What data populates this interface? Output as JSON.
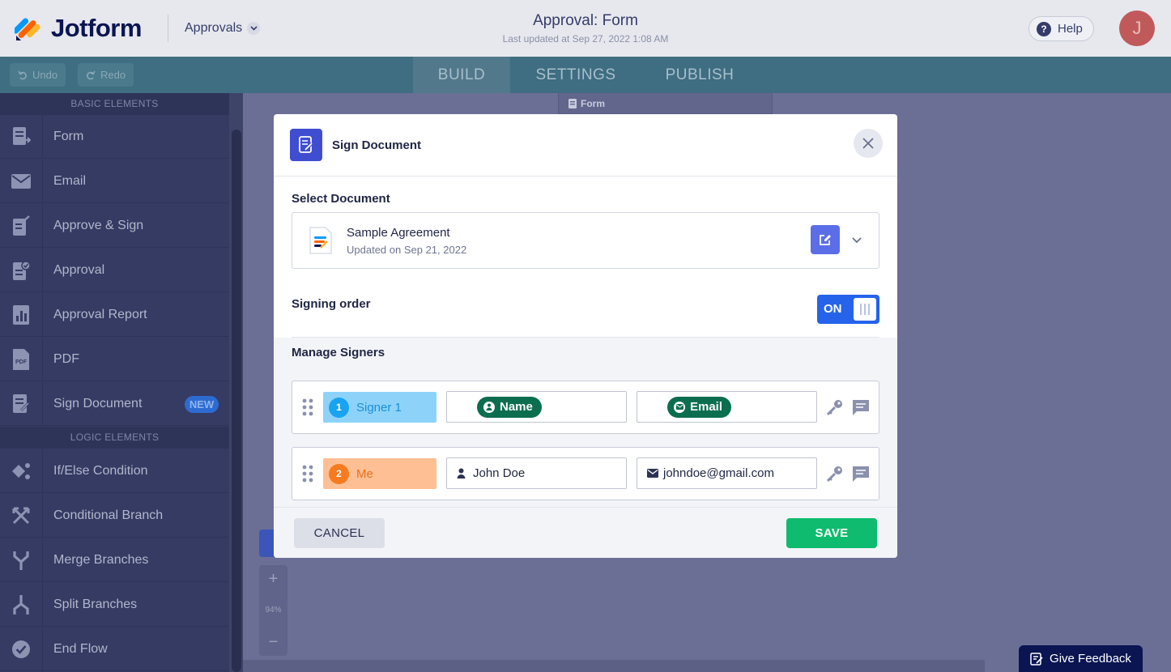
{
  "header": {
    "brand": "Jotform",
    "workspace_dropdown": "Approvals",
    "title": "Approval: Form",
    "updated": "Last updated at Sep 27, 2022 1:08 AM",
    "help_label": "Help",
    "avatar_initial": "J"
  },
  "toolbar": {
    "undo_label": "Undo",
    "redo_label": "Redo",
    "tabs": [
      {
        "label": "BUILD",
        "active": true
      },
      {
        "label": "SETTINGS",
        "active": false
      },
      {
        "label": "PUBLISH",
        "active": false
      }
    ]
  },
  "sidebar": {
    "basic_heading": "BASIC ELEMENTS",
    "basic_items": [
      {
        "label": "Form",
        "icon": "form-icon"
      },
      {
        "label": "Email",
        "icon": "envelope-icon"
      },
      {
        "label": "Approve & Sign",
        "icon": "approve-sign-icon"
      },
      {
        "label": "Approval",
        "icon": "approval-icon"
      },
      {
        "label": "Approval Report",
        "icon": "report-icon"
      },
      {
        "label": "PDF",
        "icon": "pdf-icon"
      },
      {
        "label": "Sign Document",
        "icon": "sign-document-icon",
        "badge": "NEW"
      }
    ],
    "logic_heading": "LOGIC ELEMENTS",
    "logic_items": [
      {
        "label": "If/Else Condition",
        "icon": "condition-icon"
      },
      {
        "label": "Conditional Branch",
        "icon": "conditional-branch-icon"
      },
      {
        "label": "Merge Branches",
        "icon": "merge-icon"
      },
      {
        "label": "Split Branches",
        "icon": "split-icon"
      },
      {
        "label": "End Flow",
        "icon": "end-flow-icon"
      }
    ]
  },
  "canvas": {
    "node_label": "Form",
    "zoom_in": "+",
    "zoom_level": "94%",
    "zoom_out": "−"
  },
  "feedback_label": "Give Feedback",
  "modal": {
    "title": "Sign Document",
    "select_document_label": "Select Document",
    "document": {
      "name": "Sample Agreement",
      "updated": "Updated on Sep 21, 2022"
    },
    "signing_order_label": "Signing order",
    "signing_order_toggle": "ON",
    "manage_signers_label": "Manage Signers",
    "signers": [
      {
        "number": "1",
        "role": "Signer 1",
        "name": "Name",
        "email": "Email",
        "name_is_tag": true,
        "color": "#8dd3f9",
        "num_color": "#1aa3f0",
        "text_color": "#1a8fd6"
      },
      {
        "number": "2",
        "role": "Me",
        "name": "John Doe",
        "email": "johndoe@gmail.com",
        "name_is_tag": false,
        "color": "#ffbf94",
        "num_color": "#f47b20",
        "text_color": "#e8711c"
      }
    ],
    "cancel_label": "CANCEL",
    "save_label": "SAVE"
  }
}
